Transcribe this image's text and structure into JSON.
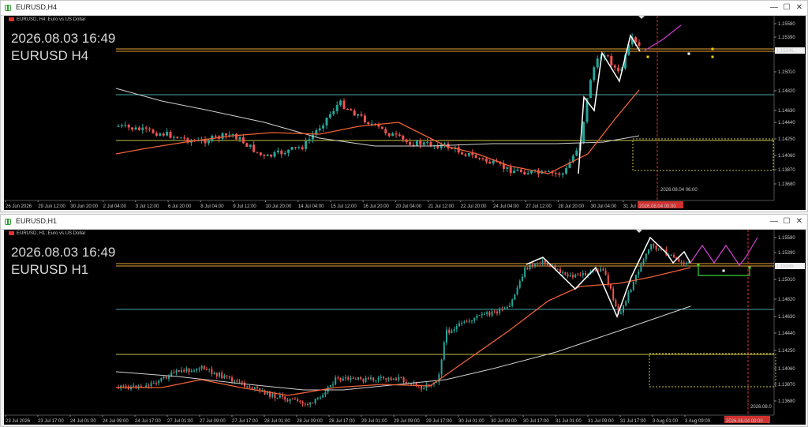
{
  "colors": {
    "bg": "#000000",
    "bull": "#26a69a",
    "bear": "#ef5350",
    "ma_red": "#f0613a",
    "ma_white": "#d0d0d0",
    "orange": "#e8a33a",
    "cyan": "#4aa3a8",
    "yellow": "#c8c04a",
    "zigzag": "#ffffff",
    "magenta": "#d040d0",
    "green": "#36d336",
    "red_line": "#e03030"
  },
  "windows": [
    {
      "title": "EURUSD,H4",
      "controls": {
        "minimize": "—",
        "maximize": "☐",
        "close": "✕"
      },
      "symbol_line": "EURUSD, H4:  Euro vs US Dollar",
      "datetime": "2026.08.03 16:49",
      "instrument": "EURUSD H4",
      "price_axis": [
        "1.15580",
        "1.15390",
        "1.15200",
        "1.15010",
        "1.14820",
        "1.14630",
        "1.14440",
        "1.14250",
        "1.14060",
        "1.13870",
        "1.13680"
      ],
      "price_tag": "1.15245",
      "time_axis": [
        "26 Jun 2026",
        "29 Jun 12:00",
        "30 Jun 20:00",
        "2 Jul 04:00",
        "3 Jul 12:00",
        "6 Jul 20:00",
        "8 Jul 04:00",
        "9 Jul 12:00",
        "10 Jul 20:00",
        "14 Jul 04:00",
        "15 Jul 12:00",
        "16 Jul 20:00",
        "20 Jul 04:00",
        "21 Jul 12:00",
        "22 Jul 20:00",
        "24 Jul 04:00",
        "27 Jul 12:00",
        "28 Jul 20:00",
        "30 Jul 04:00",
        "31 Jul 1"
      ],
      "time_tag": "2026.08.04 00:00",
      "vline_label": "2026.08.04 06:00"
    },
    {
      "title": "EURUSD,H1",
      "controls": {
        "minimize": "—",
        "maximize": "☐",
        "close": "✕"
      },
      "symbol_line": "EURUSD, H1:  Euro vs US Dollar",
      "datetime": "2026.08.03 16:49",
      "instrument": "EURUSD H1",
      "price_axis": [
        "1.15580",
        "1.15390",
        "1.15010",
        "1.14820",
        "1.14630",
        "1.14440",
        "1.14250",
        "1.14060",
        "1.13870",
        "1.13680"
      ],
      "price_tag": "1.15245",
      "time_axis": [
        "23 Jul 2026",
        "23 Jul 17:00",
        "24 Jul 01:00",
        "24 Jul 09:00",
        "24 Jul 17:00",
        "27 Jul 01:00",
        "27 Jul 09:00",
        "27 Jul 17:00",
        "28 Jul 01:00",
        "28 Jul 09:00",
        "28 Jul 17:00",
        "29 Jul 01:00",
        "29 Jul 09:00",
        "29 Jul 17:00",
        "30 Jul 01:00",
        "30 Jul 09:00",
        "30 Jul 17:00",
        "31 Jul 01:00",
        "31 Jul 09:00",
        "31 Jul 17:00",
        "3 Aug 01:00",
        "3 Aug 09:00"
      ],
      "time_tag": "2026.08.04 00:00",
      "vline_label": "2026.08.0"
    }
  ]
}
